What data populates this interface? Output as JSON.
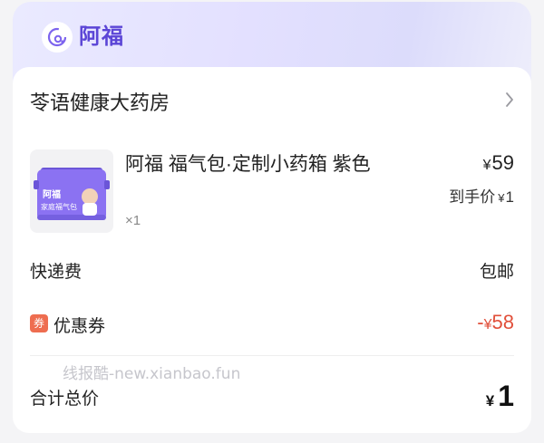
{
  "brand": {
    "name": "阿福",
    "logo_icon": "afu-logo-icon",
    "accent": "#5b45d6"
  },
  "store": {
    "name": "苓语健康大药房",
    "nav_icon": "chevron-right-icon"
  },
  "product": {
    "title": "阿福 福气包·定制小药箱 紫色",
    "quantity": "×1",
    "price_symbol": "¥",
    "price_value": "59",
    "final_label": "到手价",
    "final_symbol": "¥",
    "final_value": "1",
    "box_label_line1": "阿福",
    "box_label_line2": "家庭福气包",
    "box_color": "#8b72f2"
  },
  "shipping": {
    "label": "快递费",
    "value": "包邮"
  },
  "coupon": {
    "badge": "券",
    "label": "优惠券",
    "sign": "-",
    "symbol": "¥",
    "value": "58",
    "color": "#e14f3a"
  },
  "watermark": "线报酷-new.xianbao.fun",
  "total": {
    "label": "合计总价",
    "symbol": "¥",
    "value": "1"
  }
}
